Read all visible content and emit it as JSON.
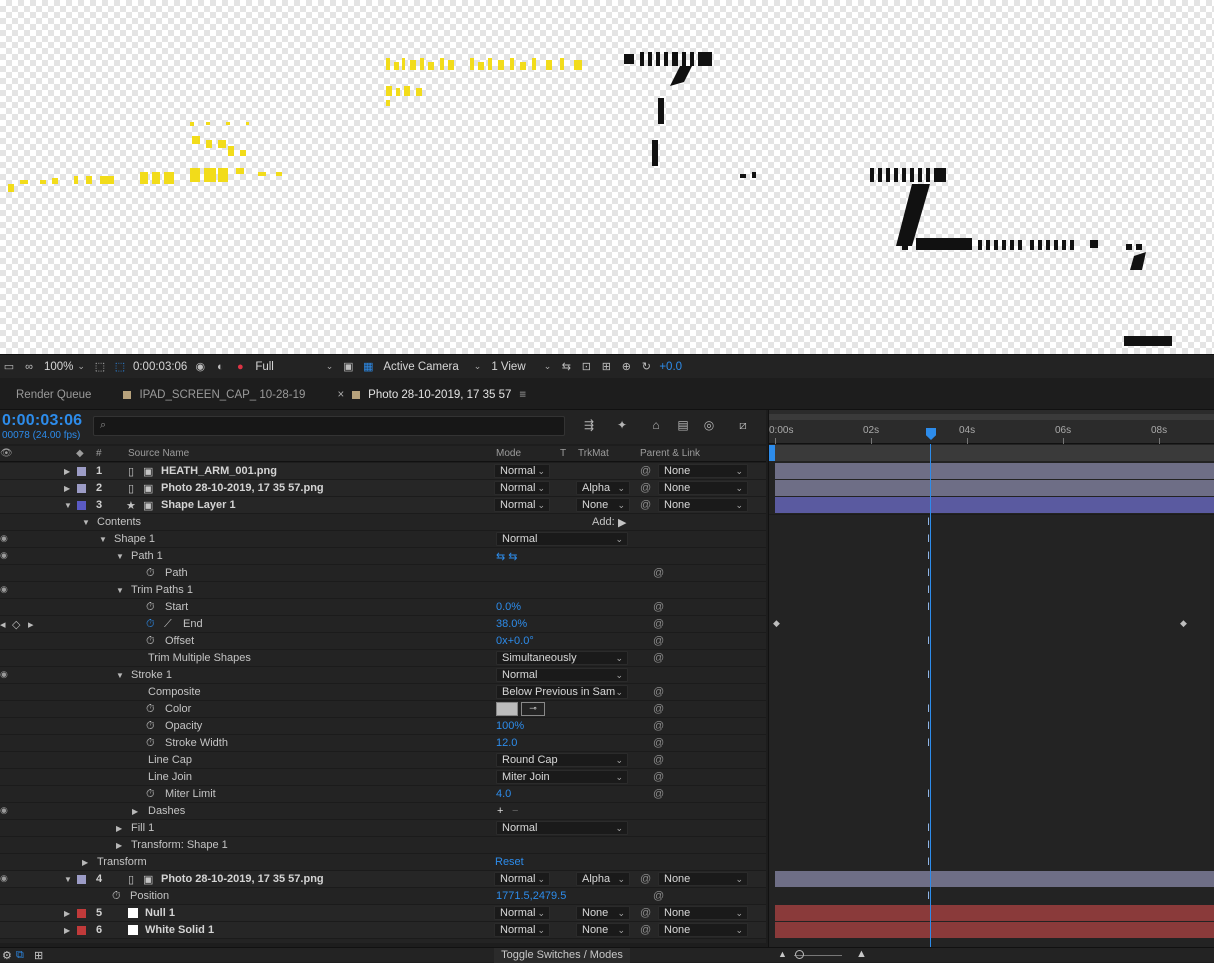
{
  "viewer": {
    "scribble_text_1": "QUICKLY MOVED",
    "scribble_text_2": "AND THE"
  },
  "viewer_toolbar": {
    "zoom": "100%",
    "time": "0:00:03:06",
    "resolution": "Full",
    "camera": "Active Camera",
    "views": "1 View",
    "exposure": "+0.0"
  },
  "tabs": [
    {
      "label": "Render Queue"
    },
    {
      "label": "IPAD_SCREEN_CAP_ 10-28-19"
    },
    {
      "label": "Photo 28-10-2019, 17 35 57"
    }
  ],
  "timeline": {
    "timecode": "0:00:03:06",
    "frames": "00078 (24.00 fps)",
    "search_placeholder": "",
    "columns": {
      "num": "#",
      "source_name": "Source Name",
      "mode": "Mode",
      "t": "T",
      "trkmat": "TrkMat",
      "parent": "Parent & Link"
    },
    "ruler": [
      "0:00s",
      "02s",
      "04s",
      "06s",
      "08s"
    ],
    "add_label": "Add:",
    "rows": [
      {
        "type": "layer",
        "num": "1",
        "name": "HEATH_ARM_001.png",
        "mode": "Normal",
        "trkmat": "",
        "parent": "None",
        "color": "#9c9cc6"
      },
      {
        "type": "layer",
        "num": "2",
        "name": "Photo 28-10-2019, 17 35 57.png",
        "mode": "Normal",
        "trkmat": "Alpha",
        "parent": "None",
        "color": "#9c9cc6"
      },
      {
        "type": "layer",
        "num": "3",
        "name": "Shape Layer 1",
        "mode": "Normal",
        "trkmat": "None",
        "parent": "None",
        "color": "#5a5ac4"
      },
      {
        "type": "prop",
        "name": "Contents"
      },
      {
        "type": "prop",
        "name": "Shape 1",
        "value": "Normal"
      },
      {
        "type": "prop",
        "name": "Path 1"
      },
      {
        "type": "prop",
        "name": "Path"
      },
      {
        "type": "prop",
        "name": "Trim Paths 1"
      },
      {
        "type": "prop",
        "name": "Start",
        "value": "0.0%"
      },
      {
        "type": "prop",
        "name": "End",
        "value": "38.0%"
      },
      {
        "type": "prop",
        "name": "Offset",
        "value": "0x+0.0°"
      },
      {
        "type": "prop",
        "name": "Trim Multiple Shapes",
        "value": "Simultaneously"
      },
      {
        "type": "prop",
        "name": "Stroke 1",
        "value": "Normal"
      },
      {
        "type": "prop",
        "name": "Composite",
        "value": "Below Previous in Sam"
      },
      {
        "type": "prop",
        "name": "Color"
      },
      {
        "type": "prop",
        "name": "Opacity",
        "value": "100%"
      },
      {
        "type": "prop",
        "name": "Stroke Width",
        "value": "12.0"
      },
      {
        "type": "prop",
        "name": "Line Cap",
        "value": "Round Cap"
      },
      {
        "type": "prop",
        "name": "Line Join",
        "value": "Miter Join"
      },
      {
        "type": "prop",
        "name": "Miter Limit",
        "value": "4.0"
      },
      {
        "type": "prop",
        "name": "Dashes"
      },
      {
        "type": "prop",
        "name": "Fill 1",
        "value": "Normal"
      },
      {
        "type": "prop",
        "name": "Transform: Shape 1"
      },
      {
        "type": "prop",
        "name": "Transform",
        "value": "Reset"
      },
      {
        "type": "layer",
        "num": "4",
        "name": "Photo 28-10-2019, 17 35 57.png",
        "mode": "Normal",
        "trkmat": "Alpha",
        "parent": "None",
        "color": "#9c9cc6"
      },
      {
        "type": "prop",
        "name": "Position",
        "value": "1771.5,2479.5"
      },
      {
        "type": "layer",
        "num": "5",
        "name": "Null 1",
        "mode": "Normal",
        "trkmat": "None",
        "parent": "None",
        "color": "#c03a3a"
      },
      {
        "type": "layer",
        "num": "6",
        "name": "White Solid 1",
        "mode": "Normal",
        "trkmat": "None",
        "parent": "None",
        "color": "#c03a3a"
      }
    ]
  },
  "bottom": {
    "toggle_label": "Toggle Switches / Modes"
  },
  "colors": {
    "accent": "#2d8ceb",
    "bar_gray": "#6e6e86",
    "bar_blue": "#5a5aa0",
    "bar_red": "#8a3a3a"
  }
}
